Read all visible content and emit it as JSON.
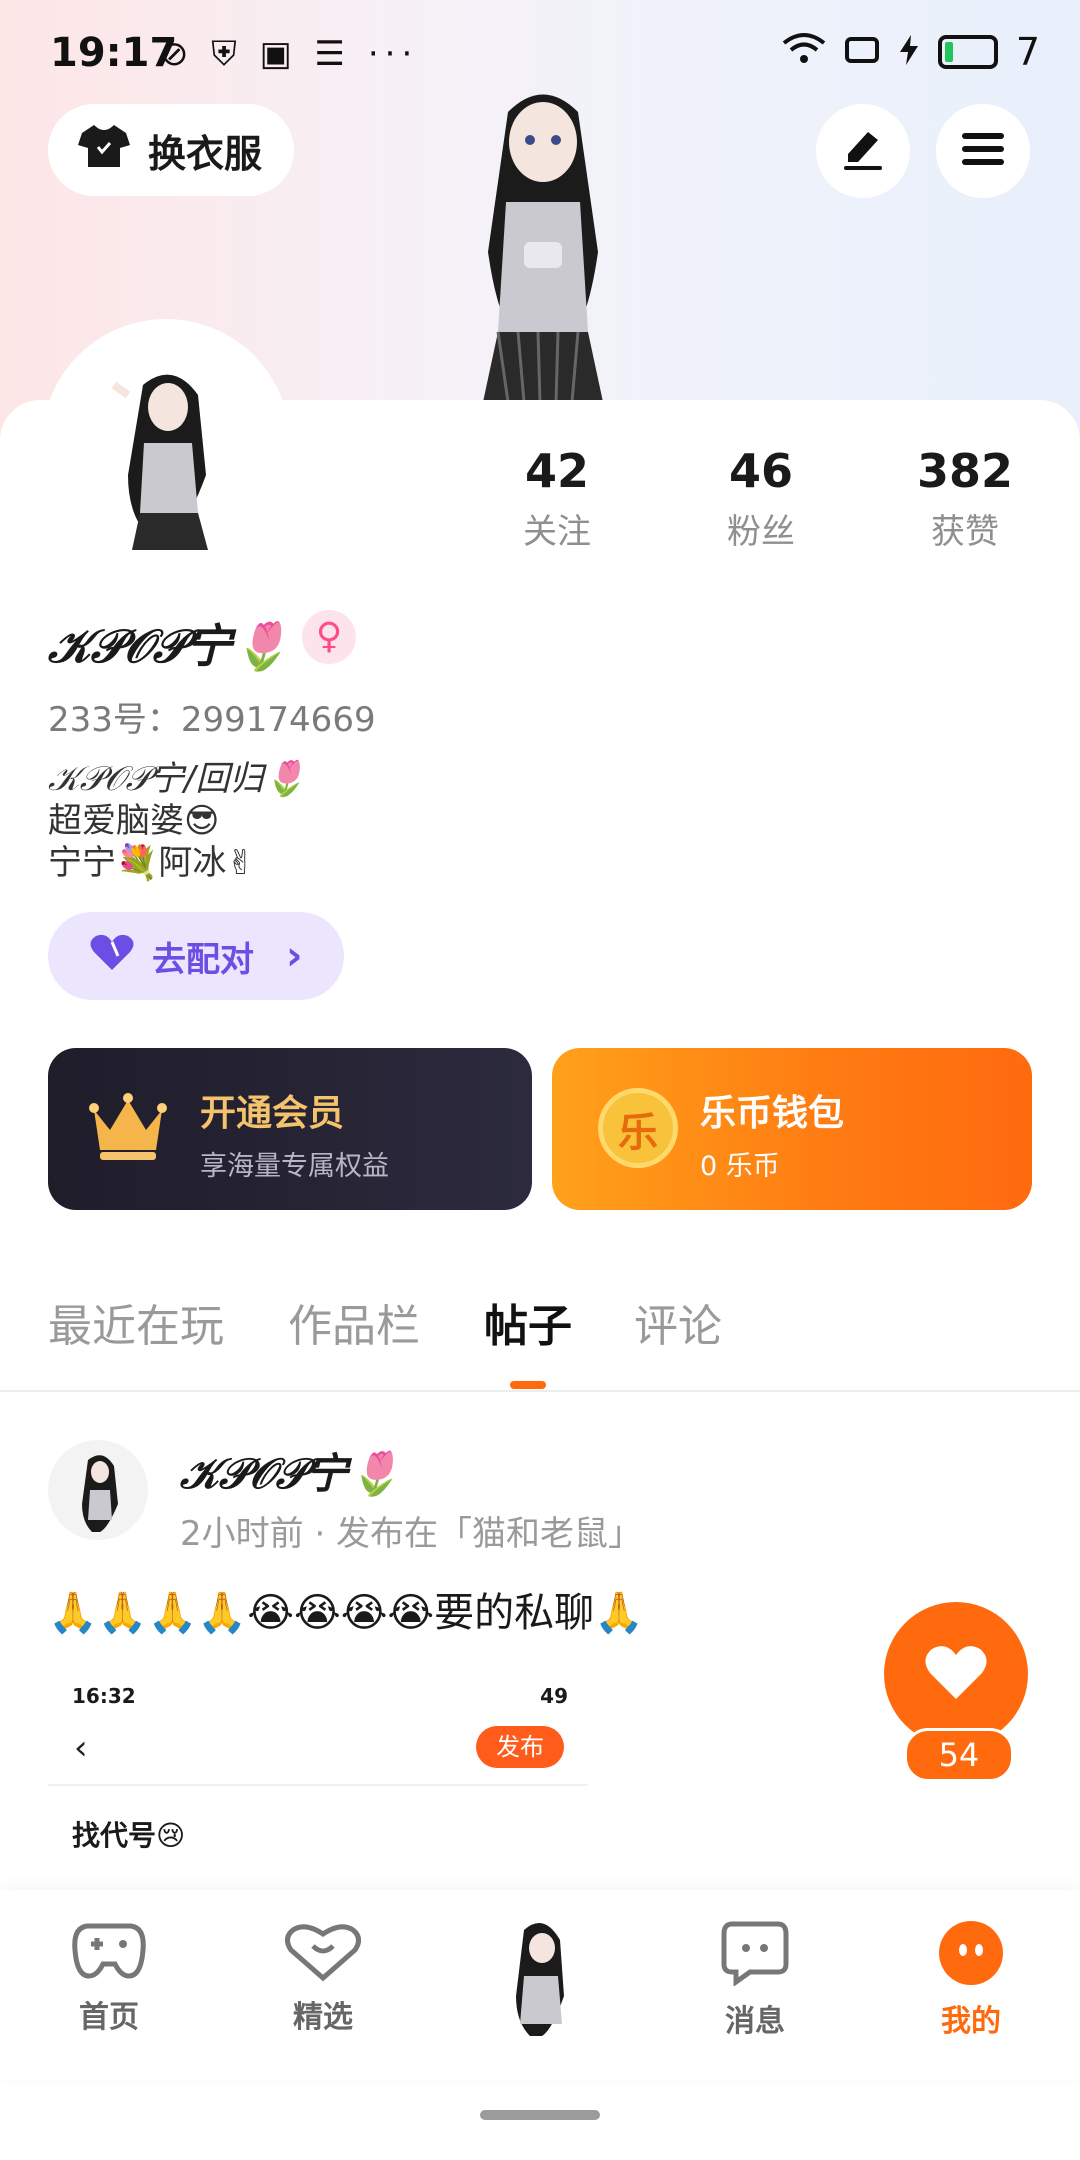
{
  "status_bar": {
    "time": "19:17",
    "left_icons": "⊘ ⛨ ▣ ☰ ···",
    "battery": "7"
  },
  "header": {
    "outfit_button": "换衣服",
    "edit_icon": "edit-icon",
    "menu_icon": "menu-icon"
  },
  "stats": [
    {
      "value": "42",
      "label": "关注"
    },
    {
      "value": "46",
      "label": "粉丝"
    },
    {
      "value": "382",
      "label": "获赞"
    }
  ],
  "profile": {
    "nickname": "𝒦𝒫𝒪𝒫宁🌷",
    "gender_symbol": "♀",
    "uid": "233号：299174669",
    "bio_lines": [
      "𝒦𝒫𝒪𝒫宁/回归🌷",
      "超爱脑婆😎",
      "宁宁💐阿冰✌"
    ],
    "pair_button": "去配对",
    "pair_chevron": "›"
  },
  "vip_card": {
    "title": "开通会员",
    "subtitle": "享海量专属权益",
    "icon": "crown-icon"
  },
  "wallet_card": {
    "title": "乐币钱包",
    "subtitle": "0 乐币",
    "coin_char": "乐"
  },
  "tabs": [
    "最近在玩",
    "作品栏",
    "帖子",
    "评论"
  ],
  "active_tab": "帖子",
  "post": {
    "author": "𝒦𝒫𝒪𝒫宁🌷",
    "meta": "2小时前 · 发布在「猫和老鼠」",
    "text": "🙏🙏🙏🙏😭😭😭😭要的私聊🙏",
    "screenshot": {
      "time": "16:32",
      "right": "49",
      "back": "‹",
      "publish": "发布",
      "title": "找代号😢"
    },
    "like_count": "54"
  },
  "bottom_nav": [
    {
      "label": "首页",
      "icon": "gamepad-icon"
    },
    {
      "label": "精选",
      "icon": "heart-chat-icon"
    },
    {
      "label": "消息",
      "icon": "message-icon"
    },
    {
      "label": "我的",
      "icon": "face-icon"
    }
  ],
  "colors": {
    "accent": "#ff6a0f",
    "pair": "#6d4ee4",
    "vip_gold": "#f5c36b"
  }
}
